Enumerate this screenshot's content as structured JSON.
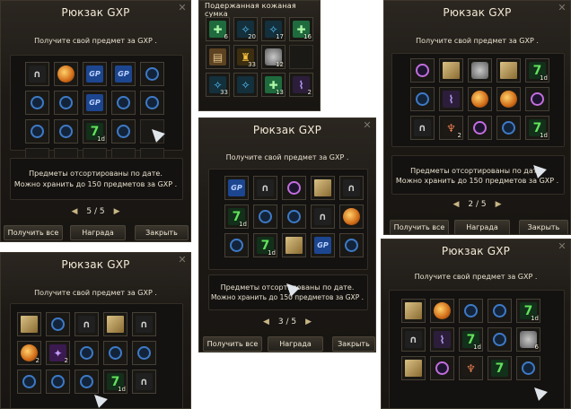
{
  "win_title": "Рюкзак GXP",
  "hint": "Получите свой предмет за GXP .",
  "desc1": "Предметы отсортированы по дате.",
  "desc2": "Можно хранить до 150 предметов за GXP .",
  "buttons": {
    "get_all": "Получить все",
    "reward": "Награда",
    "close": "Закрыть"
  },
  "panels": [
    {
      "page": "5 / 5",
      "rows": 3,
      "icons": [
        "pant",
        "orb",
        "gxp",
        "gxp",
        "chain",
        "chain",
        "chain",
        "gxp",
        "chain",
        "chain",
        "chain",
        "chain",
        "seven",
        "chain",
        "empty",
        "empty",
        "empty",
        "empty",
        "empty",
        "empty"
      ],
      "counts": {
        "12": "1d"
      }
    },
    {
      "page": "",
      "rows": 3,
      "icons": [
        "scroll",
        "chain",
        "pant",
        "scroll",
        "pant",
        "orb",
        "star",
        "chain",
        "chain",
        "chain",
        "chain",
        "chain",
        "chain",
        "seven",
        "pant"
      ],
      "counts": {
        "5": "2",
        "6": "2",
        "13": "1d"
      }
    },
    {
      "page": "3 / 5",
      "rows": 3,
      "icons": [
        "gxp",
        "pant",
        "ring",
        "scroll",
        "pant",
        "seven",
        "chain",
        "chain",
        "pant",
        "orb",
        "chain",
        "seven",
        "scroll",
        "gxp",
        "chain"
      ],
      "counts": {
        "5": "1d",
        "11": "1d"
      }
    },
    {
      "page": "2 / 5",
      "rows": 3,
      "icons": [
        "ring",
        "scroll",
        "bag",
        "scroll",
        "seven",
        "chain",
        "horn",
        "orb",
        "orb",
        "ring",
        "pant",
        "amulet",
        "ring",
        "chain",
        "seven"
      ],
      "counts": {
        "4": "1d",
        "11": "2",
        "14": "1d"
      }
    },
    {
      "page": "",
      "rows": 3,
      "icons": [
        "scroll",
        "orb",
        "chain",
        "chain",
        "seven",
        "pant",
        "horn",
        "seven",
        "chain",
        "bag",
        "scroll",
        "ring",
        "amulet",
        "seven",
        "chain"
      ],
      "counts": {
        "4": "1d",
        "7": "1d",
        "9": "6"
      }
    }
  ],
  "bag": {
    "title": "Подержанная кожаная сумка",
    "items": [
      {
        "icon": "cross",
        "count": "6"
      },
      {
        "icon": "wand",
        "count": "20"
      },
      {
        "icon": "wand",
        "count": "17"
      },
      {
        "icon": "cross",
        "count": "16"
      },
      {
        "icon": "book",
        "count": ""
      },
      {
        "icon": "pot",
        "count": "33"
      },
      {
        "icon": "bag",
        "count": "12"
      },
      {
        "icon": "empty",
        "count": ""
      },
      {
        "icon": "wand",
        "count": "33"
      },
      {
        "icon": "wand",
        "count": ""
      },
      {
        "icon": "cross",
        "count": "13"
      },
      {
        "icon": "horn",
        "count": "2"
      }
    ]
  },
  "glyphs": {
    "pant": "∩",
    "seven": "7",
    "gxp": "GP",
    "horn": "⌇",
    "amulet": "♆",
    "star": "✦",
    "book": "▤",
    "pot": "♜",
    "wand": "✧",
    "cross": "✚",
    "orb": "",
    "chain": "",
    "scroll": "",
    "bag": "",
    "ring": ""
  }
}
